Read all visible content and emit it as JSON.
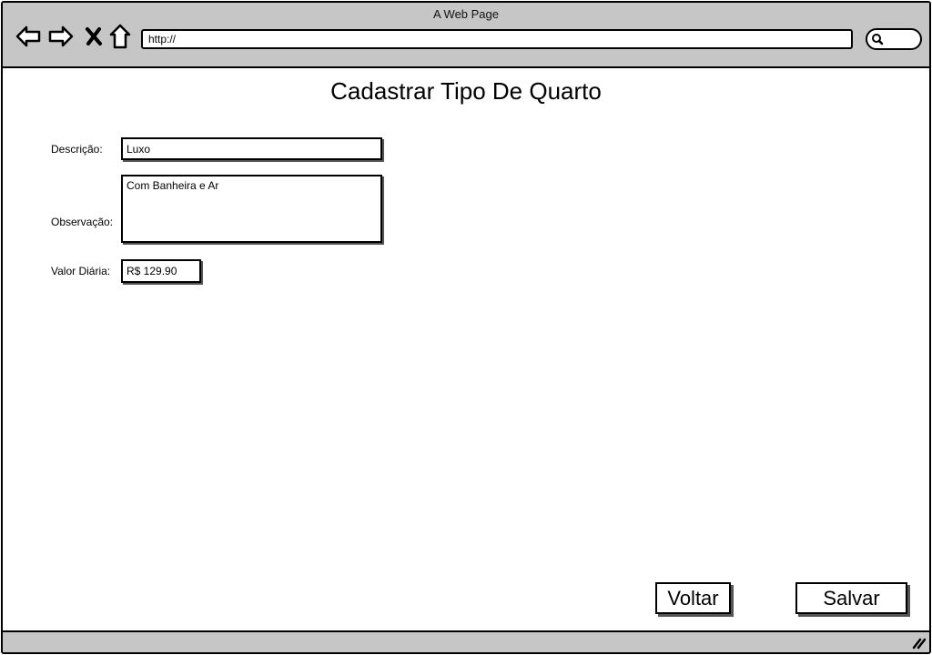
{
  "window": {
    "title": "A Web Page"
  },
  "browser": {
    "url": "http://",
    "icons": {
      "back": "arrow-left-icon",
      "forward": "arrow-right-icon",
      "stop": "close-icon",
      "home": "home-icon",
      "search": "search-icon"
    }
  },
  "page": {
    "title": "Cadastrar Tipo De Quarto"
  },
  "form": {
    "descricao": {
      "label": "Descrição:",
      "value": "Luxo"
    },
    "observacao": {
      "label": "Observação:",
      "value": "Com Banheira e Ar"
    },
    "valor_diaria": {
      "label": "Valor Diária:",
      "value": "R$ 129.90"
    }
  },
  "actions": {
    "back_label": "Voltar",
    "save_label": "Salvar"
  },
  "colors": {
    "chrome": "#c6c6c6",
    "border": "#000000",
    "background": "#ffffff"
  }
}
